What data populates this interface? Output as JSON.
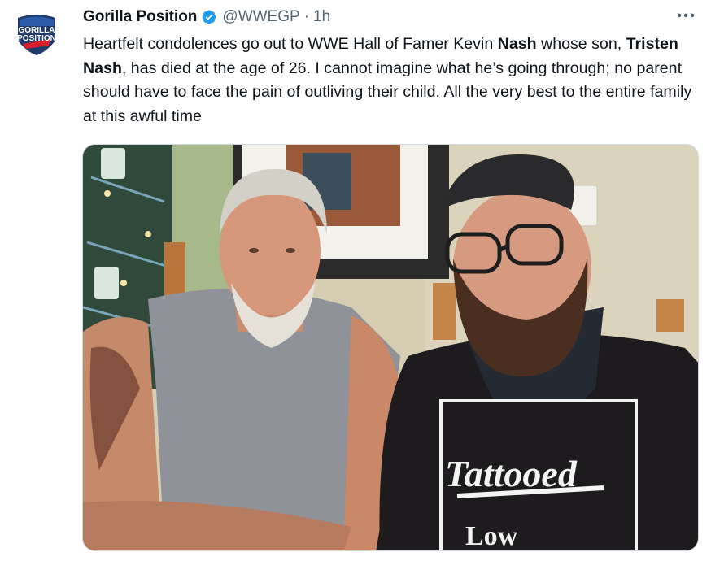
{
  "author": {
    "display_name": "Gorilla Position",
    "handle": "@WWEGP",
    "separator": "·",
    "time": "1h",
    "avatar_logo_text": [
      "GORILLA",
      "POSITION"
    ],
    "verified": true
  },
  "more_button": "more-dots-icon",
  "tweet": {
    "t1": "Heartfelt condolences go out to WWE Hall of Famer Kevin ",
    "t1_bold": "Nash",
    "t2": " whose son, ",
    "t2_bold": "Tristen Nash",
    "t3": ", has died at the age of 26. I cannot imagine what he’s going through; no parent should have to face the pain of outliving their child. All the very best to the entire family at this awful time"
  },
  "media": {
    "shirt_text": "Tattooed",
    "shirt_text_2": "Low"
  },
  "colors": {
    "text": "#0f1419",
    "secondary": "#536471",
    "verified": "#1d9bf0",
    "border": "#cfd9de"
  }
}
